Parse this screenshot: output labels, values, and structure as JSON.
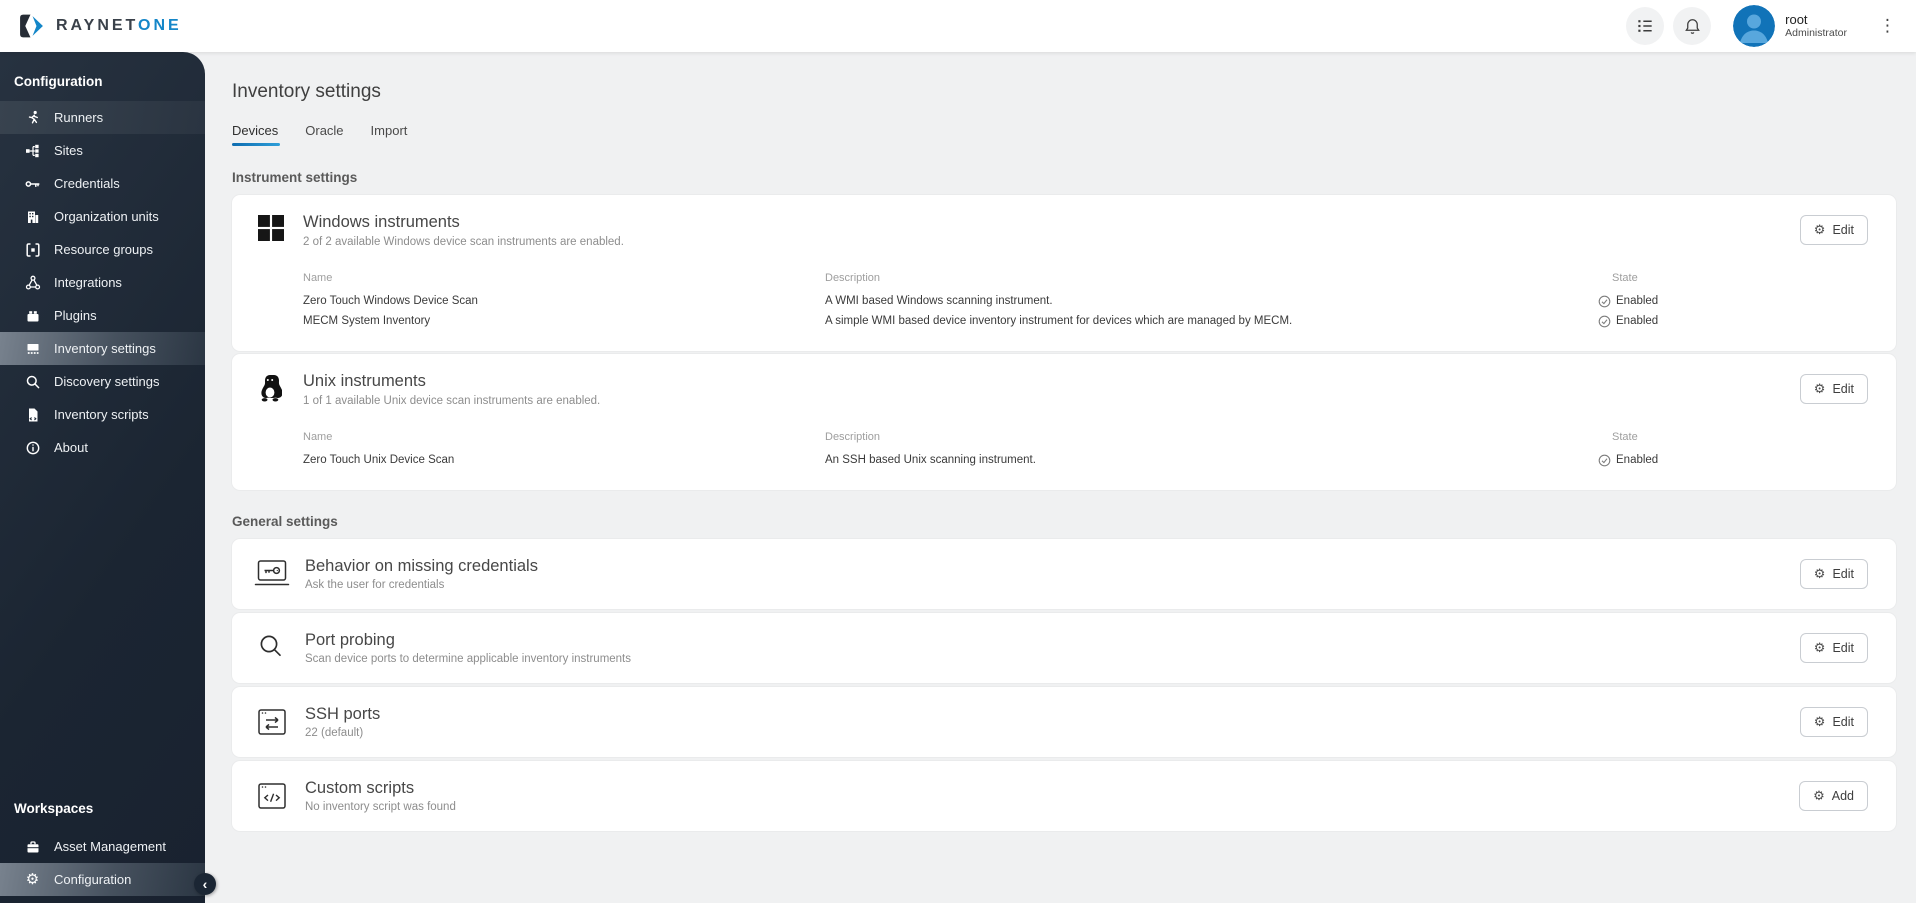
{
  "brand": {
    "name": "RAYNET",
    "accent": "ONE"
  },
  "topbar": {
    "user_name": "root",
    "user_role": "Administrator"
  },
  "sidebar": {
    "title": "Configuration",
    "items": [
      {
        "label": "Runners"
      },
      {
        "label": "Sites"
      },
      {
        "label": "Credentials"
      },
      {
        "label": "Organization units"
      },
      {
        "label": "Resource groups"
      },
      {
        "label": "Integrations"
      },
      {
        "label": "Plugins"
      },
      {
        "label": "Inventory settings",
        "active": "true"
      },
      {
        "label": "Discovery settings"
      },
      {
        "label": "Inventory scripts"
      },
      {
        "label": "About"
      }
    ],
    "workspaces_title": "Workspaces",
    "workspaces": [
      {
        "label": "Asset Management"
      },
      {
        "label": "Configuration",
        "active": "true"
      }
    ]
  },
  "main": {
    "title": "Inventory settings",
    "tabs": [
      {
        "label": "Devices",
        "active": "true"
      },
      {
        "label": "Oracle"
      },
      {
        "label": "Import"
      }
    ],
    "instruments": {
      "heading": "Instrument settings",
      "columns": {
        "name": "Name",
        "description": "Description",
        "state": "State"
      },
      "groups": [
        {
          "title": "Windows instruments",
          "subtitle": "2 of 2 available Windows device scan instruments are enabled.",
          "button": "Edit",
          "rows": [
            {
              "name": "Zero Touch Windows Device Scan",
              "description": "A WMI based Windows scanning instrument.",
              "state": "Enabled"
            },
            {
              "name": "MECM System Inventory",
              "description": "A simple WMI based device inventory instrument for devices which are managed by MECM.",
              "state": "Enabled"
            }
          ]
        },
        {
          "title": "Unix instruments",
          "subtitle": "1 of 1 available Unix device scan instruments are enabled.",
          "button": "Edit",
          "rows": [
            {
              "name": "Zero Touch Unix Device Scan",
              "description": "An SSH based Unix scanning instrument.",
              "state": "Enabled"
            }
          ]
        }
      ]
    },
    "general": {
      "heading": "General settings",
      "cards": [
        {
          "title": "Behavior on missing credentials",
          "subtitle": "Ask the user for credentials",
          "button": "Edit"
        },
        {
          "title": "Port probing",
          "subtitle": "Scan device ports to determine applicable inventory instruments",
          "button": "Edit"
        },
        {
          "title": "SSH ports",
          "subtitle": "22 (default)",
          "button": "Edit"
        },
        {
          "title": "Custom scripts",
          "subtitle": "No inventory script was found",
          "button": "Add"
        }
      ]
    }
  },
  "icons": {
    "gear": "⚙",
    "collapse": "‹",
    "kebab": "⋮"
  },
  "colors": {
    "accent_blue": "#1486c8",
    "sidebar_bg": "#1f2a38",
    "content_bg": "#f0f1f2",
    "topbar_bg": "#ffffff"
  }
}
